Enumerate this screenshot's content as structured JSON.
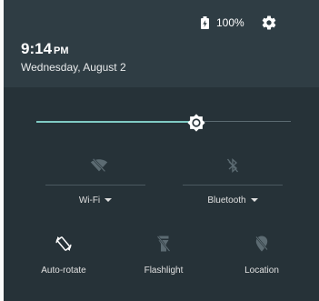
{
  "status_bar": {
    "battery_text": "100%",
    "battery_icon": "battery-charging-icon",
    "settings_icon": "gear-icon"
  },
  "header": {
    "time": "9:14",
    "ampm": "PM",
    "date": "Wednesday, August 2"
  },
  "brightness": {
    "level_percent": 63,
    "icon": "brightness-icon"
  },
  "toggles": {
    "wifi": {
      "label": "Wi-Fi",
      "icon": "wifi-off-icon",
      "state": "off"
    },
    "bluetooth": {
      "label": "Bluetooth",
      "icon": "bluetooth-off-icon",
      "state": "off"
    }
  },
  "tiles": [
    {
      "label": "Auto-rotate",
      "icon": "rotate-icon",
      "state": "on"
    },
    {
      "label": "Flashlight",
      "icon": "flashlight-off-icon",
      "state": "off"
    },
    {
      "label": "Location",
      "icon": "location-off-icon",
      "state": "off"
    }
  ],
  "colors": {
    "accent": "#80cbc4",
    "panel": "#263238",
    "header": "#2f3d44",
    "inactive_icon": "#5c6b72"
  }
}
